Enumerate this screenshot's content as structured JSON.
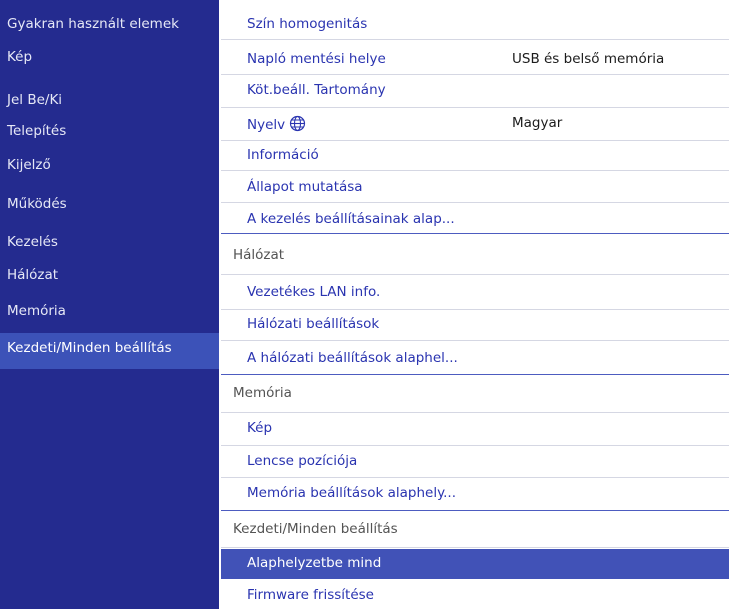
{
  "sidebar": {
    "items": [
      {
        "label": "Gyakran használt elemek"
      },
      {
        "label": "Kép"
      },
      {
        "label": "Jel Be/Ki"
      },
      {
        "label": "Telepítés"
      },
      {
        "label": "Kijelző"
      },
      {
        "label": "Működés"
      },
      {
        "label": "Kezelés"
      },
      {
        "label": "Hálózat"
      },
      {
        "label": "Memória"
      },
      {
        "label": "Kezdeti/Minden beállítás",
        "selected": true
      }
    ]
  },
  "main": {
    "rows": [
      {
        "label": "Szín homogenitás"
      },
      {
        "label": "Napló mentési helye",
        "value": "USB és belső memória"
      },
      {
        "label": "Köt.beáll. Tartomány"
      },
      {
        "label": "Nyelv",
        "icon": "globe-icon",
        "value": "Magyar"
      },
      {
        "label": "Információ"
      },
      {
        "label": "Állapot mutatása"
      },
      {
        "label": "A kezelés beállításainak alap..."
      },
      {
        "header": "Hálózat"
      },
      {
        "label": "Vezetékes LAN info."
      },
      {
        "label": "Hálózati beállítások"
      },
      {
        "label": "A hálózati beállítások alaphel..."
      },
      {
        "header": "Memória"
      },
      {
        "label": "Kép"
      },
      {
        "label": "Lencse pozíciója"
      },
      {
        "label": "Memória beállítások alaphely..."
      },
      {
        "header": "Kezdeti/Minden beállítás"
      },
      {
        "label": "Alaphelyzetbe mind",
        "selected": true
      },
      {
        "label": "Firmware frissítése"
      }
    ]
  },
  "colors": {
    "sidebar_bg": "#242b8f",
    "sidebar_selected": "#3c52b8",
    "row_selected": "#4152b7",
    "link_text": "#2a34b0"
  }
}
